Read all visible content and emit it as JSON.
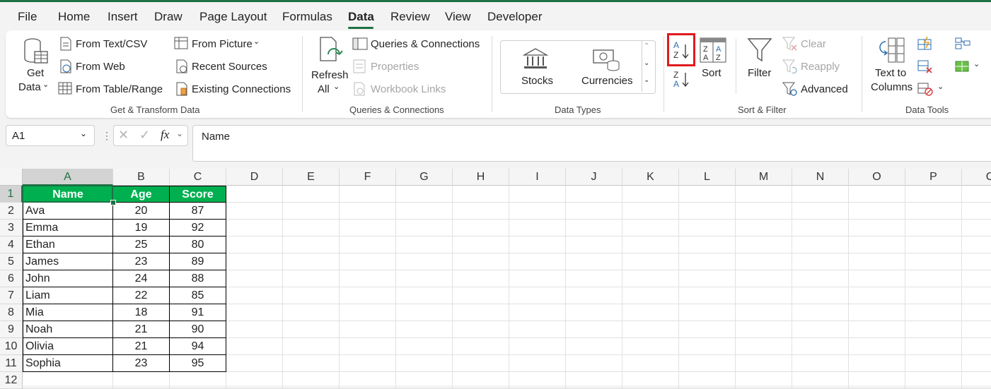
{
  "tabs": [
    "File",
    "Home",
    "Insert",
    "Draw",
    "Page Layout",
    "Formulas",
    "Data",
    "Review",
    "View",
    "Developer"
  ],
  "active_tab": "Data",
  "ribbon": {
    "get_transform": {
      "get_data_line1": "Get",
      "get_data_line2": "Data",
      "from_text_csv": "From Text/CSV",
      "from_web": "From Web",
      "from_table_range": "From Table/Range",
      "from_picture": "From Picture",
      "recent_sources": "Recent Sources",
      "existing_connections": "Existing Connections",
      "group_label": "Get & Transform Data"
    },
    "queries": {
      "refresh_line1": "Refresh",
      "refresh_line2": "All",
      "queries_connections": "Queries & Connections",
      "properties": "Properties",
      "workbook_links": "Workbook Links",
      "group_label": "Queries & Connections"
    },
    "data_types": {
      "stocks": "Stocks",
      "currencies": "Currencies",
      "group_label": "Data Types"
    },
    "sort_filter": {
      "sort": "Sort",
      "filter": "Filter",
      "clear": "Clear",
      "reapply": "Reapply",
      "advanced": "Advanced",
      "group_label": "Sort & Filter"
    },
    "data_tools": {
      "text_to_columns_line1": "Text to",
      "text_to_columns_line2": "Columns",
      "group_label": "Data Tools"
    }
  },
  "formula_bar": {
    "name_box": "A1",
    "fx": "fx",
    "content": "Name"
  },
  "columns": [
    "A",
    "B",
    "C",
    "D",
    "E",
    "F",
    "G",
    "H",
    "I",
    "J",
    "K",
    "L",
    "M",
    "N",
    "O",
    "P",
    "C"
  ],
  "rows": [
    "1",
    "2",
    "3",
    "4",
    "5",
    "6",
    "7",
    "8",
    "9",
    "10",
    "11",
    "12"
  ],
  "table": {
    "headers": [
      "Name",
      "Age",
      "Score"
    ],
    "rows": [
      [
        "Ava",
        "20",
        "87"
      ],
      [
        "Emma",
        "19",
        "92"
      ],
      [
        "Ethan",
        "25",
        "80"
      ],
      [
        "James",
        "23",
        "89"
      ],
      [
        "John",
        "24",
        "88"
      ],
      [
        "Liam",
        "22",
        "85"
      ],
      [
        "Mia",
        "18",
        "91"
      ],
      [
        "Noah",
        "21",
        "90"
      ],
      [
        "Olivia",
        "21",
        "94"
      ],
      [
        "Sophia",
        "23",
        "95"
      ]
    ]
  },
  "colors": {
    "accent": "#1e7145",
    "header_fill": "#00b050",
    "highlight": "#e0191f"
  }
}
